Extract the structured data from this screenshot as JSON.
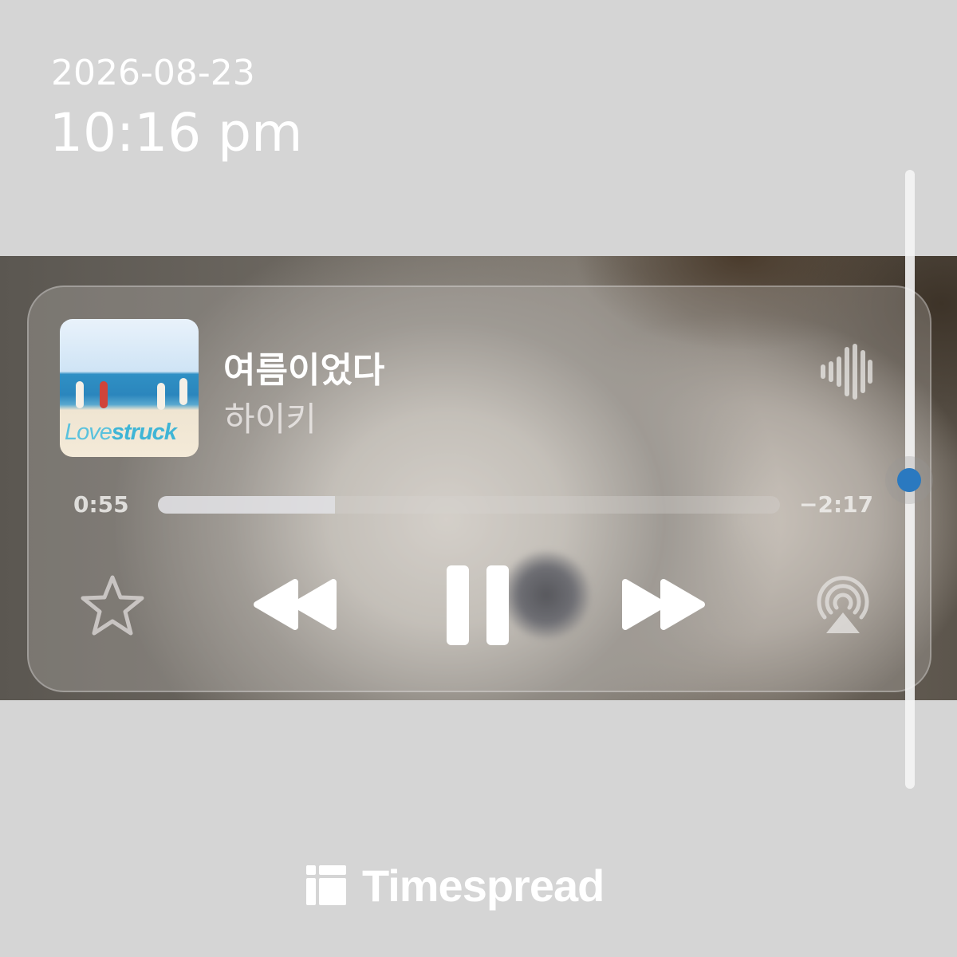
{
  "header": {
    "date": "2026-08-23",
    "time": "10:16 pm"
  },
  "now_playing": {
    "album_art_text": {
      "prefix": "Love",
      "suffix": "struck"
    },
    "title": "여름이었다",
    "artist": "하이키",
    "elapsed": "0:55",
    "remaining": "−2:17",
    "progress": 0.285
  },
  "controls": {
    "icons": [
      "star-icon",
      "rewind-icon",
      "pause-icon",
      "fast-forward-icon",
      "airplay-icon",
      "waveform-icon"
    ]
  },
  "scrollbar": {
    "position_fraction": 0.5
  },
  "footer": {
    "brand": "Timespread"
  },
  "colors": {
    "background": "#d5d5d5",
    "accent": "#2a79c0",
    "text": "#ffffff"
  }
}
